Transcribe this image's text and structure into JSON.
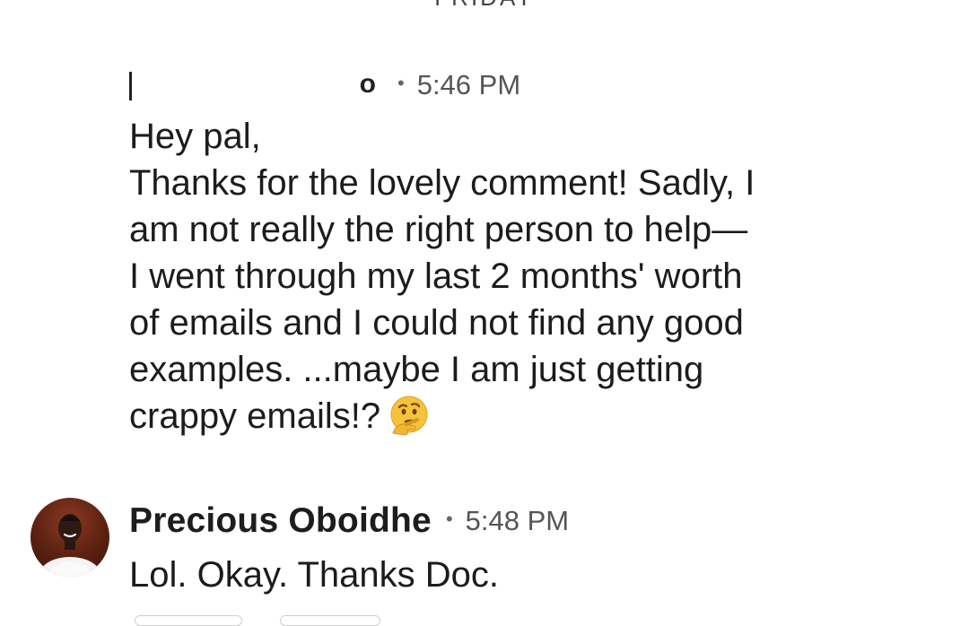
{
  "day_divider": "FRIDAY",
  "messages": [
    {
      "sender": "",
      "sender_tail": "o",
      "separator": "•",
      "time": "5:46 PM",
      "lines": [
        "Hey pal,",
        "Thanks for the lovely comment! Sadly, I",
        "am not really the right person to help—",
        "I went through my last 2 months' worth",
        "of emails and I could not find any good",
        "examples. ...maybe I am just getting",
        "crappy emails!?"
      ],
      "emoji": "thinking-face-icon"
    },
    {
      "sender": "Precious Oboidhe",
      "separator": "•",
      "time": "5:48 PM",
      "lines": [
        "Lol. Okay. Thanks Doc."
      ],
      "avatar": "profile-photo"
    }
  ],
  "colors": {
    "background": "#ffffff",
    "text": "#1c1c1c",
    "timestamp": "#555555",
    "emoji": "#f5c33b"
  }
}
